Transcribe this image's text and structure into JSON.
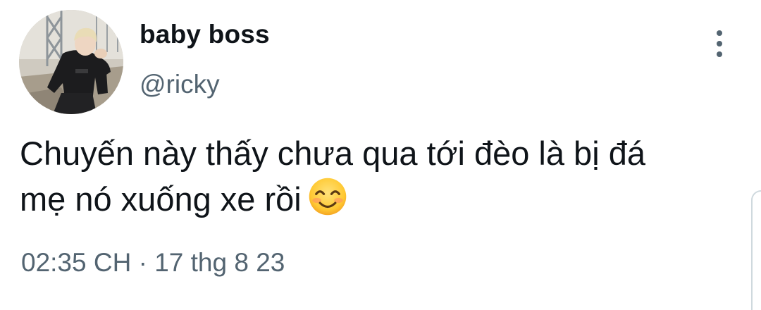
{
  "author": {
    "display_name": "baby boss",
    "handle": "@ricky"
  },
  "tweet": {
    "text_line1": "Chuyến này thấy chưa qua tới đèo là bị đá",
    "text_line2": "mẹ nó xuống xe rồi",
    "emoji": "smiling-face-with-smiling-eyes",
    "timestamp": "02:35 CH · 17 thg 8 23"
  },
  "icons": {
    "more": "more-vertical-icon",
    "avatar": "profile-photo"
  },
  "colors": {
    "text_primary": "#0f1419",
    "text_secondary": "#536471",
    "background": "#ffffff"
  }
}
